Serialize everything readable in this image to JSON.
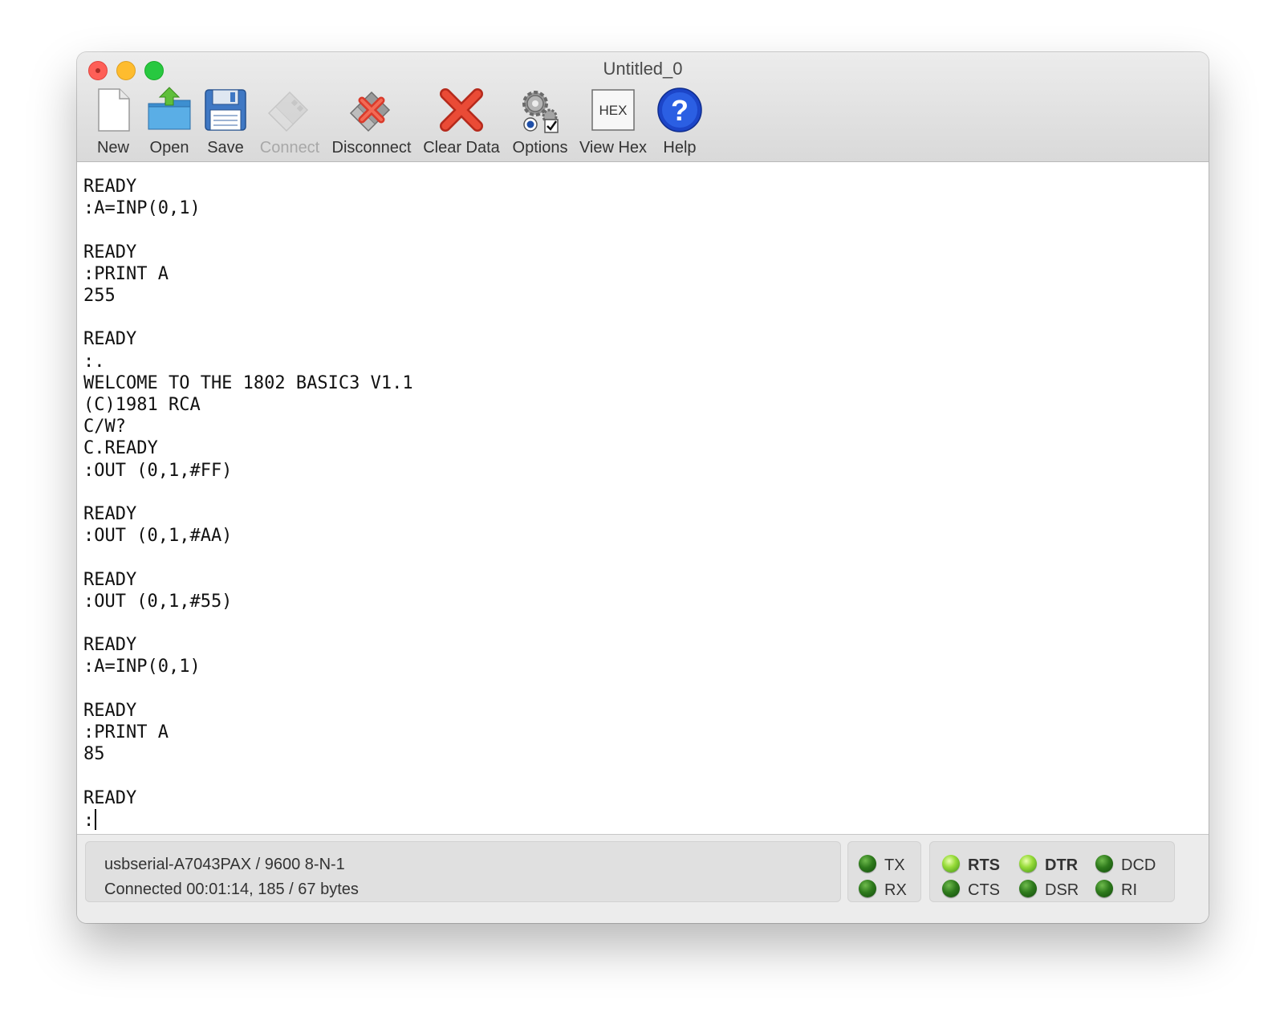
{
  "window": {
    "title": "Untitled_0"
  },
  "toolbar": {
    "buttons": [
      {
        "label": "New",
        "icon": "new-document-icon",
        "enabled": true
      },
      {
        "label": "Open",
        "icon": "open-folder-icon",
        "enabled": true
      },
      {
        "label": "Save",
        "icon": "floppy-disk-icon",
        "enabled": true
      },
      {
        "label": "Connect",
        "icon": "usb-plug-icon",
        "enabled": false
      },
      {
        "label": "Disconnect",
        "icon": "usb-plug-x-icon",
        "enabled": true
      },
      {
        "label": "Clear Data",
        "icon": "red-x-icon",
        "enabled": true
      },
      {
        "label": "Options",
        "icon": "gears-icon",
        "enabled": true
      },
      {
        "label": "View Hex",
        "icon": "hex-icon",
        "enabled": true
      },
      {
        "label": "Help",
        "icon": "help-question-icon",
        "enabled": true
      }
    ],
    "hex_icon_text": "HEX",
    "help_icon_text": "?"
  },
  "terminal": {
    "text": "READY\n:A=INP(0,1)\n\nREADY\n:PRINT A\n255\n\nREADY\n:.\nWELCOME TO THE 1802 BASIC3 V1.1\n(C)1981 RCA\nC/W?\nC.READY\n:OUT (0,1,#FF)\n\nREADY\n:OUT (0,1,#AA)\n\nREADY\n:OUT (0,1,#55)\n\nREADY\n:A=INP(0,1)\n\nREADY\n:PRINT A\n85\n\nREADY\n:"
  },
  "status": {
    "port": "usbserial-A7043PAX / 9600 8-N-1",
    "connection": "Connected 00:01:14, 185 / 67 bytes",
    "signals": {
      "tx": {
        "label": "TX",
        "on": false
      },
      "rx": {
        "label": "RX",
        "on": false
      },
      "rts": {
        "label": "RTS",
        "on": true
      },
      "cts": {
        "label": "CTS",
        "on": false
      },
      "dtr": {
        "label": "DTR",
        "on": true
      },
      "dsr": {
        "label": "DSR",
        "on": false
      },
      "dcd": {
        "label": "DCD",
        "on": false
      },
      "ri": {
        "label": "RI",
        "on": false
      }
    }
  },
  "colors": {
    "led_on": "#98dc3a",
    "led_off": "#2e7a1c",
    "close": "#fe5f57",
    "minimize": "#febc2e",
    "maximize": "#28c840"
  }
}
